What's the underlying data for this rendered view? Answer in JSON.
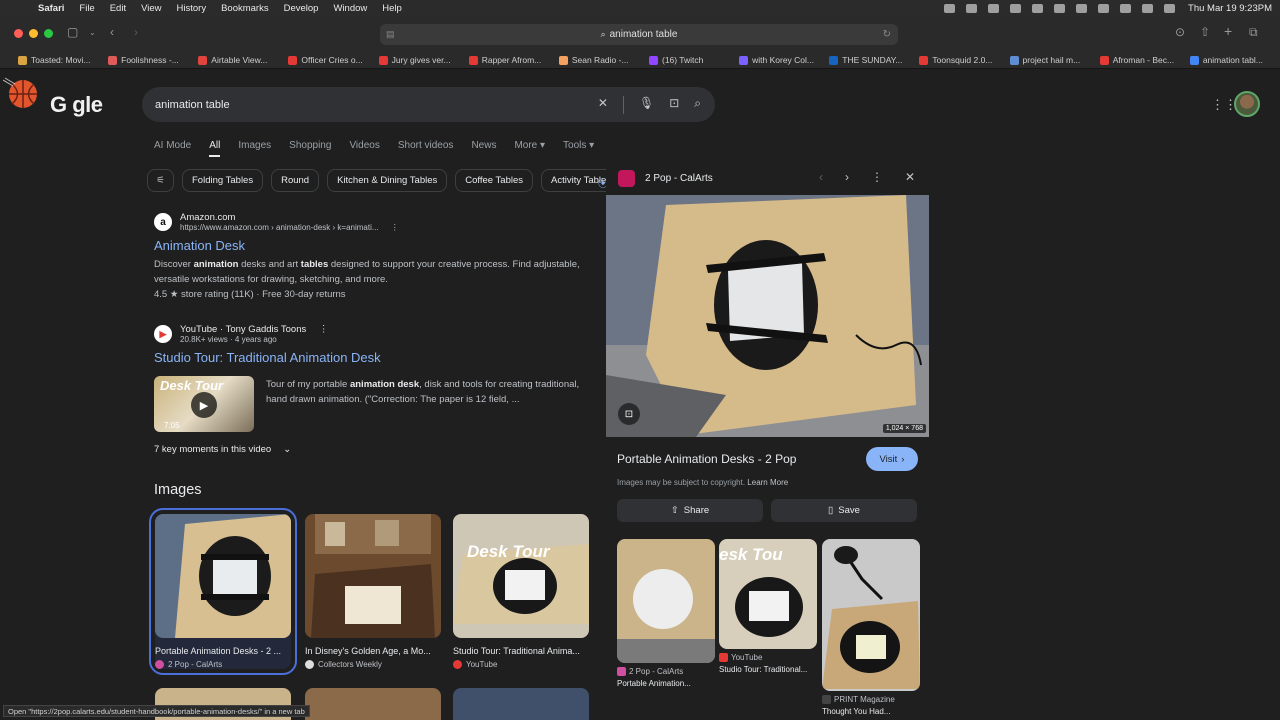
{
  "menubar": {
    "app": "Safari",
    "items": [
      "File",
      "Edit",
      "View",
      "History",
      "Bookmarks",
      "Develop",
      "Window",
      "Help"
    ],
    "clock": "Thu Mar 19  9:23PM"
  },
  "toolbar": {
    "url": "animation table"
  },
  "bookmarks": [
    {
      "label": "Toasted: Movi...",
      "color": "#d9a441"
    },
    {
      "label": "Foolishness -...",
      "color": "#e05a5a"
    },
    {
      "label": "Airtable View...",
      "color": "#e0443c"
    },
    {
      "label": "Officer Cries o...",
      "color": "#e53935"
    },
    {
      "label": "Jury gives ver...",
      "color": "#e53935"
    },
    {
      "label": "Rapper Afrom...",
      "color": "#e53935"
    },
    {
      "label": "Sean Radio -...",
      "color": "#f4a261"
    },
    {
      "label": "(16) Twitch",
      "color": "#9146ff"
    },
    {
      "label": "with Korey Col...",
      "color": "#7b61ff"
    },
    {
      "label": "THE SUNDAY...",
      "color": "#1565c0"
    },
    {
      "label": "Toonsquid 2.0...",
      "color": "#e53935"
    },
    {
      "label": "project hail m...",
      "color": "#5f8dd3"
    },
    {
      "label": "Afroman - Bec...",
      "color": "#e53935"
    },
    {
      "label": "animation tabl...",
      "color": "#4285f4"
    }
  ],
  "google": {
    "logo_text": "G  gle",
    "query": "animation table",
    "tabs": [
      "AI Mode",
      "All",
      "Images",
      "Shopping",
      "Videos",
      "Short videos",
      "News",
      "More ▾",
      "Tools ▾"
    ],
    "chips": [
      "Folding Tables",
      "Round",
      "Kitchen & Dining Tables",
      "Coffee Tables",
      "Activity Tables"
    ]
  },
  "results": [
    {
      "site": "Amazon.com",
      "url": "https://www.amazon.com › animation-desk › k=animati...",
      "title": "Animation Desk",
      "snippet_pre": "Discover ",
      "snippet_b1": "animation",
      "snippet_mid": " desks and art ",
      "snippet_b2": "tables",
      "snippet_post": " designed to support your creative process. Find adjustable, versatile workstations for drawing, sketching, and more.",
      "rating": "4.5 ★ store rating (11K) · Free 30-day returns"
    },
    {
      "site": "YouTube · Tony Gaddis Toons",
      "url": "20.8K+ views · 4 years ago",
      "title": "Studio Tour: Traditional Animation Desk",
      "snippet_pre": "Tour of my portable ",
      "snippet_b1": "animation desk",
      "snippet_post": ", disk and tools for creating traditional, hand drawn animation. (\"Correction: The paper is 12 field, ...",
      "thumb_text": "Desk Tour",
      "duration": "7:05"
    }
  ],
  "key_moments": "7 key moments in this video",
  "images_heading": "Images",
  "image_cards": [
    {
      "caption": "Portable Animation Desks - 2 ...",
      "source": "2 Pop - CalArts",
      "dot": "#d04fa0"
    },
    {
      "caption": "In Disney's Golden Age, a Mo...",
      "source": "Collectors Weekly",
      "dot": "#dddddd"
    },
    {
      "caption": "Studio Tour: Traditional Anima...",
      "source": "YouTube",
      "dot": "#e53935",
      "thumb_text": "Desk Tour"
    }
  ],
  "panel": {
    "source": "2 Pop - CalArts",
    "image_size": "1,024 × 768",
    "title": "Portable Animation Desks - 2 Pop",
    "visit": "Visit",
    "copyright": "Images may be subject to copyright.",
    "learn_more": "Learn More",
    "share": "Share",
    "save": "Save",
    "related": [
      {
        "source": "2 Pop - CalArts",
        "caption": "Portable Animation...",
        "dot": "#d04fa0"
      },
      {
        "source": "YouTube",
        "caption": "Studio Tour: Traditional...",
        "dot": "#e53935",
        "thumb_text": "esk Tou"
      },
      {
        "source": "PRINT Magazine",
        "caption": "Thought You Had...",
        "dot": "#444444"
      }
    ]
  },
  "status_url": "Open \"https://2pop.calarts.edu/student-handbook/portable-animation-desks/\" in a new tab",
  "colors": {
    "link": "#8ab4f8",
    "background": "#1f1f1f",
    "accent": "#4b6fd8"
  }
}
